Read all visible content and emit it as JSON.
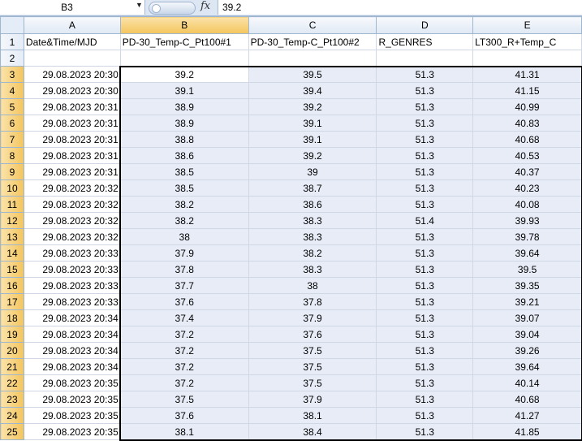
{
  "formula_bar": {
    "name_box": "B3",
    "fx_label": "fx",
    "formula": "39.2"
  },
  "columns": [
    "A",
    "B",
    "C",
    "D",
    "E"
  ],
  "header_row": [
    "Date&Time/MJD",
    "PD-30_Temp-C_Pt100#1",
    "PD-30_Temp-C_Pt100#2",
    "R_GENRES",
    "LT300_R+Temp_C"
  ],
  "rows": [
    {
      "n": "3",
      "a": "29.08.2023 20:30",
      "b": "39.2",
      "c": "39.5",
      "d": "51.3",
      "e": "41.31"
    },
    {
      "n": "4",
      "a": "29.08.2023 20:30",
      "b": "39.1",
      "c": "39.4",
      "d": "51.3",
      "e": "41.15"
    },
    {
      "n": "5",
      "a": "29.08.2023 20:31",
      "b": "38.9",
      "c": "39.2",
      "d": "51.3",
      "e": "40.99"
    },
    {
      "n": "6",
      "a": "29.08.2023 20:31",
      "b": "38.9",
      "c": "39.1",
      "d": "51.3",
      "e": "40.83"
    },
    {
      "n": "7",
      "a": "29.08.2023 20:31",
      "b": "38.8",
      "c": "39.1",
      "d": "51.3",
      "e": "40.68"
    },
    {
      "n": "8",
      "a": "29.08.2023 20:31",
      "b": "38.6",
      "c": "39.2",
      "d": "51.3",
      "e": "40.53"
    },
    {
      "n": "9",
      "a": "29.08.2023 20:31",
      "b": "38.5",
      "c": "39",
      "d": "51.3",
      "e": "40.37"
    },
    {
      "n": "10",
      "a": "29.08.2023 20:32",
      "b": "38.5",
      "c": "38.7",
      "d": "51.3",
      "e": "40.23"
    },
    {
      "n": "11",
      "a": "29.08.2023 20:32",
      "b": "38.2",
      "c": "38.6",
      "d": "51.3",
      "e": "40.08"
    },
    {
      "n": "12",
      "a": "29.08.2023 20:32",
      "b": "38.2",
      "c": "38.3",
      "d": "51.4",
      "e": "39.93"
    },
    {
      "n": "13",
      "a": "29.08.2023 20:32",
      "b": "38",
      "c": "38.3",
      "d": "51.3",
      "e": "39.78"
    },
    {
      "n": "14",
      "a": "29.08.2023 20:33",
      "b": "37.9",
      "c": "38.2",
      "d": "51.3",
      "e": "39.64"
    },
    {
      "n": "15",
      "a": "29.08.2023 20:33",
      "b": "37.8",
      "c": "38.3",
      "d": "51.3",
      "e": "39.5"
    },
    {
      "n": "16",
      "a": "29.08.2023 20:33",
      "b": "37.7",
      "c": "38",
      "d": "51.3",
      "e": "39.35"
    },
    {
      "n": "17",
      "a": "29.08.2023 20:33",
      "b": "37.6",
      "c": "37.8",
      "d": "51.3",
      "e": "39.21"
    },
    {
      "n": "18",
      "a": "29.08.2023 20:34",
      "b": "37.4",
      "c": "37.9",
      "d": "51.3",
      "e": "39.07"
    },
    {
      "n": "19",
      "a": "29.08.2023 20:34",
      "b": "37.2",
      "c": "37.6",
      "d": "51.3",
      "e": "39.04"
    },
    {
      "n": "20",
      "a": "29.08.2023 20:34",
      "b": "37.2",
      "c": "37.5",
      "d": "51.3",
      "e": "39.26"
    },
    {
      "n": "21",
      "a": "29.08.2023 20:34",
      "b": "37.2",
      "c": "37.5",
      "d": "51.3",
      "e": "39.64"
    },
    {
      "n": "22",
      "a": "29.08.2023 20:35",
      "b": "37.2",
      "c": "37.5",
      "d": "51.3",
      "e": "40.14"
    },
    {
      "n": "23",
      "a": "29.08.2023 20:35",
      "b": "37.5",
      "c": "37.9",
      "d": "51.3",
      "e": "40.68"
    },
    {
      "n": "24",
      "a": "29.08.2023 20:35",
      "b": "37.6",
      "c": "38.1",
      "d": "51.3",
      "e": "41.27"
    },
    {
      "n": "25",
      "a": "29.08.2023 20:35",
      "b": "38.1",
      "c": "38.4",
      "d": "51.3",
      "e": "41.85"
    }
  ],
  "colors": {
    "selection_fill": "#e7ecf7",
    "header_selected": "#f4c55e",
    "grid_line": "#d0d7e5"
  }
}
